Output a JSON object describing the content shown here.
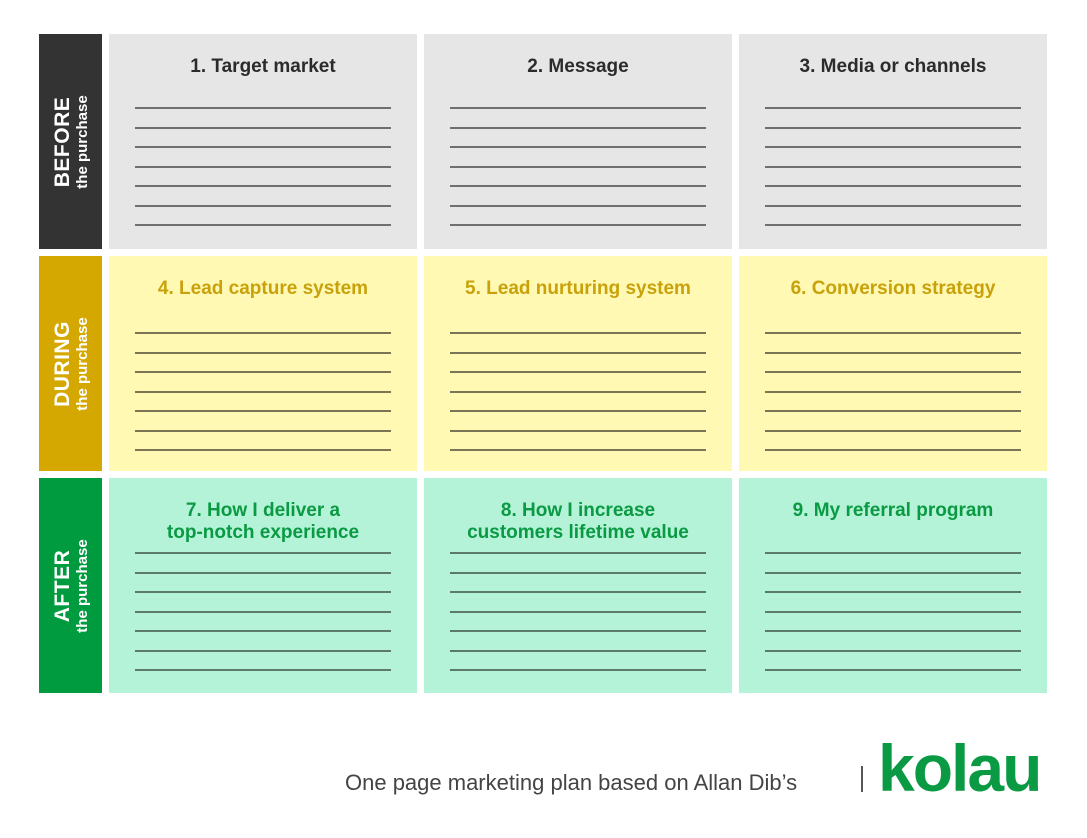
{
  "rows": [
    {
      "stage": "BEFORE",
      "sub": "the purchase",
      "color": "#333333",
      "cells": [
        {
          "title": "1. Target market"
        },
        {
          "title": "2. Message"
        },
        {
          "title": "3. Media or channels"
        }
      ]
    },
    {
      "stage": "DURING",
      "sub": "the purchase",
      "color": "#d4a800",
      "cells": [
        {
          "title": "4. Lead capture system"
        },
        {
          "title": "5. Lead nurturing system"
        },
        {
          "title": "6. Conversion strategy"
        }
      ]
    },
    {
      "stage": "AFTER",
      "sub": "the purchase",
      "color": "#009a3f",
      "cells": [
        {
          "title": "7. How I deliver a\ntop-notch experience"
        },
        {
          "title": "8. How I increase\ncustomers lifetime value"
        },
        {
          "title": "9. My referral program"
        }
      ]
    }
  ],
  "footer": {
    "text": "One page marketing plan based on Allan Dib’s",
    "logo": "kolau",
    "brand_color": "#0a9a43"
  }
}
